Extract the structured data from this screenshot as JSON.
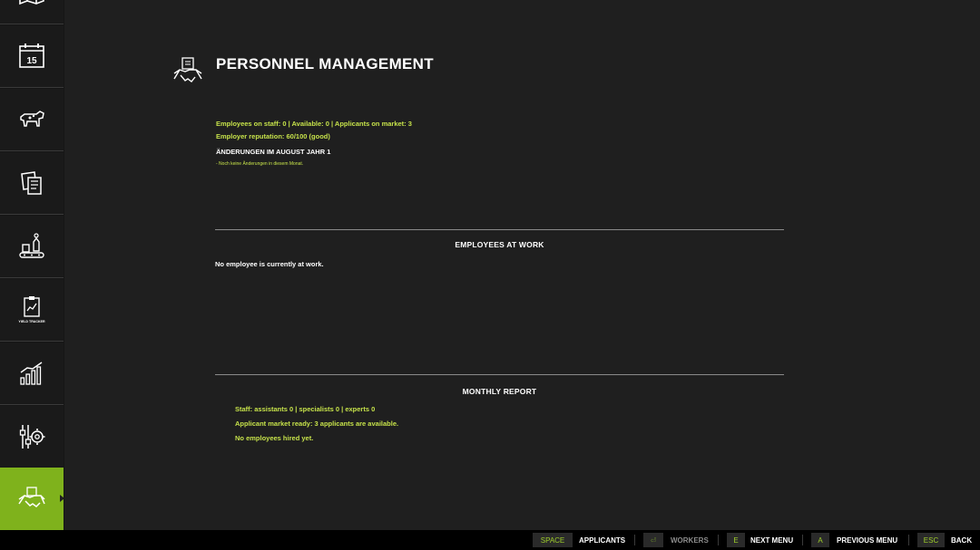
{
  "sidebar": {
    "items": [
      {
        "icon": "map-icon"
      },
      {
        "icon": "calendar-icon",
        "label": "15"
      },
      {
        "icon": "animals-icon"
      },
      {
        "icon": "contracts-icon"
      },
      {
        "icon": "production-icon"
      },
      {
        "icon": "yield-tracker-icon",
        "label": "YIELD TRACKER"
      },
      {
        "icon": "statistics-icon"
      },
      {
        "icon": "settings-icon"
      },
      {
        "icon": "handshake-icon",
        "active": true
      }
    ]
  },
  "header": {
    "title": "PERSONNEL MANAGEMENT",
    "icon": "handshake-contract-icon"
  },
  "summary": {
    "staff_line": "Employees on staff: 0 | Available: 0 | Applicants on market: 3",
    "reputation_line": "Employer reputation: 60/100 (good)",
    "changes_heading": "ÄNDERUNGEN IM AUGUST JAHR 1",
    "changes_note": "- Noch keine Änderungen in diesem Monat."
  },
  "employees_at_work": {
    "title": "EMPLOYEES AT WORK",
    "empty_text": "No employee is currently at work."
  },
  "monthly_report": {
    "title": "MONTHLY REPORT",
    "lines": [
      "Staff: assistants 0 | specialists 0 | experts 0",
      "Applicant market ready: 3 applicants are available.",
      "No employees hired yet."
    ]
  },
  "footer": {
    "actions": [
      {
        "key": "SPACE",
        "label": "APPLICANTS"
      },
      {
        "key": "⏎",
        "label": "WORKERS",
        "disabled": true
      },
      {
        "key": "E",
        "label": "NEXT MENU"
      },
      {
        "key": "A",
        "label": "PREVIOUS MENU"
      },
      {
        "key": "ESC",
        "label": "BACK"
      }
    ]
  },
  "colors": {
    "accent": "#7fb21c",
    "highlight_text": "#c6e24a",
    "background": "#1f1f1f"
  }
}
